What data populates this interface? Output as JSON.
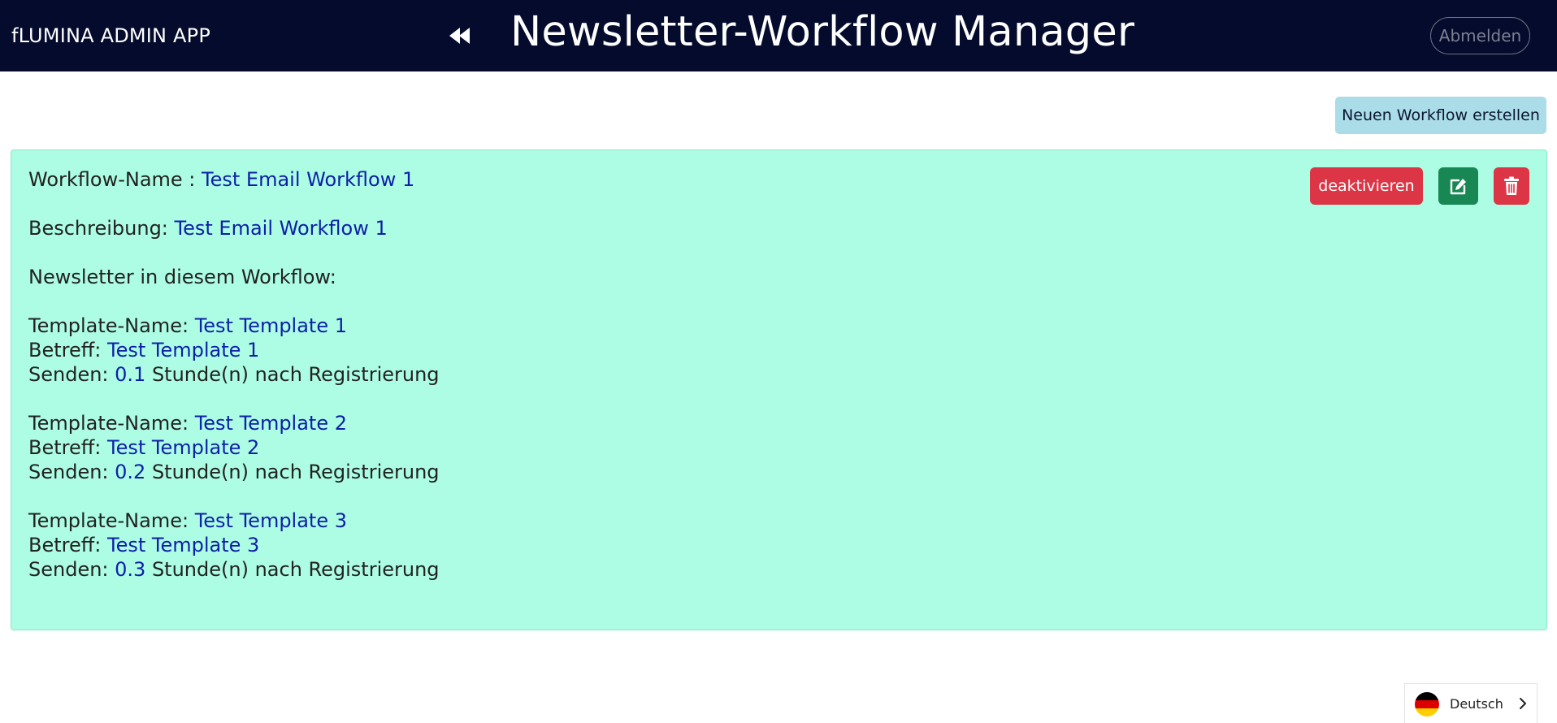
{
  "header": {
    "brand": "fLUMINA ADMIN APP",
    "title": "Newsletter-Workflow Manager",
    "logout_label": "Abmelden",
    "back_icon": "double-chevron-left-icon"
  },
  "toolbar": {
    "new_workflow_label": "Neuen Workflow erstellen"
  },
  "workflow": {
    "name_label": "Workflow-Name : ",
    "name": "Test Email Workflow 1",
    "description_label": "Beschreibung: ",
    "description": "Test Email Workflow 1",
    "newsletters_heading": "Newsletter in diesem Workflow:",
    "template_name_label": "Template-Name: ",
    "subject_label": "Betreff: ",
    "send_label": "Senden: ",
    "send_suffix": " Stunde(n) nach Registrierung",
    "newsletters": [
      {
        "template_name": "Test Template 1",
        "subject": "Test Template 1",
        "hours": "0.1"
      },
      {
        "template_name": "Test Template 2",
        "subject": "Test Template 2",
        "hours": "0.2"
      },
      {
        "template_name": "Test Template 3",
        "subject": "Test Template 3",
        "hours": "0.3"
      }
    ],
    "actions": {
      "deactivate_label": "deaktivieren",
      "edit_icon": "edit-icon",
      "delete_icon": "trash-icon"
    }
  },
  "language": {
    "label": "Deutsch",
    "flag_icon": "german-flag-icon"
  },
  "colors": {
    "navbar": "#040b2c",
    "card": "#acfde3",
    "value_text": "#0e1fa8",
    "danger": "#dc3545",
    "success": "#198754",
    "info": "#abdde9"
  }
}
